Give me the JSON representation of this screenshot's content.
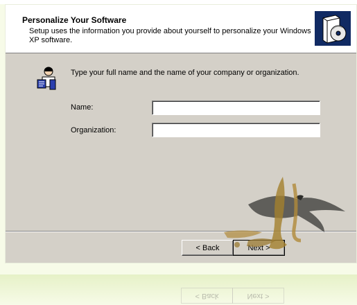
{
  "header": {
    "title": "Personalize Your Software",
    "subtitle": "Setup uses the information you provide about yourself to personalize your Windows XP software.",
    "logo_icon": "software-box-cd-icon"
  },
  "intro": {
    "icon": "wizard-person-icon",
    "text": "Type your full name and the name of your company or organization."
  },
  "form": {
    "name_label": "Name:",
    "name_value": "",
    "organization_label": "Organization:",
    "organization_value": ""
  },
  "buttons": {
    "back_label": "< Back",
    "next_label": "Next >"
  },
  "colors": {
    "dialog_bg": "#d4d0c8",
    "header_bg": "#ffffff",
    "logo_bg": "#102a63",
    "page_bg": "#f7fbe8"
  }
}
